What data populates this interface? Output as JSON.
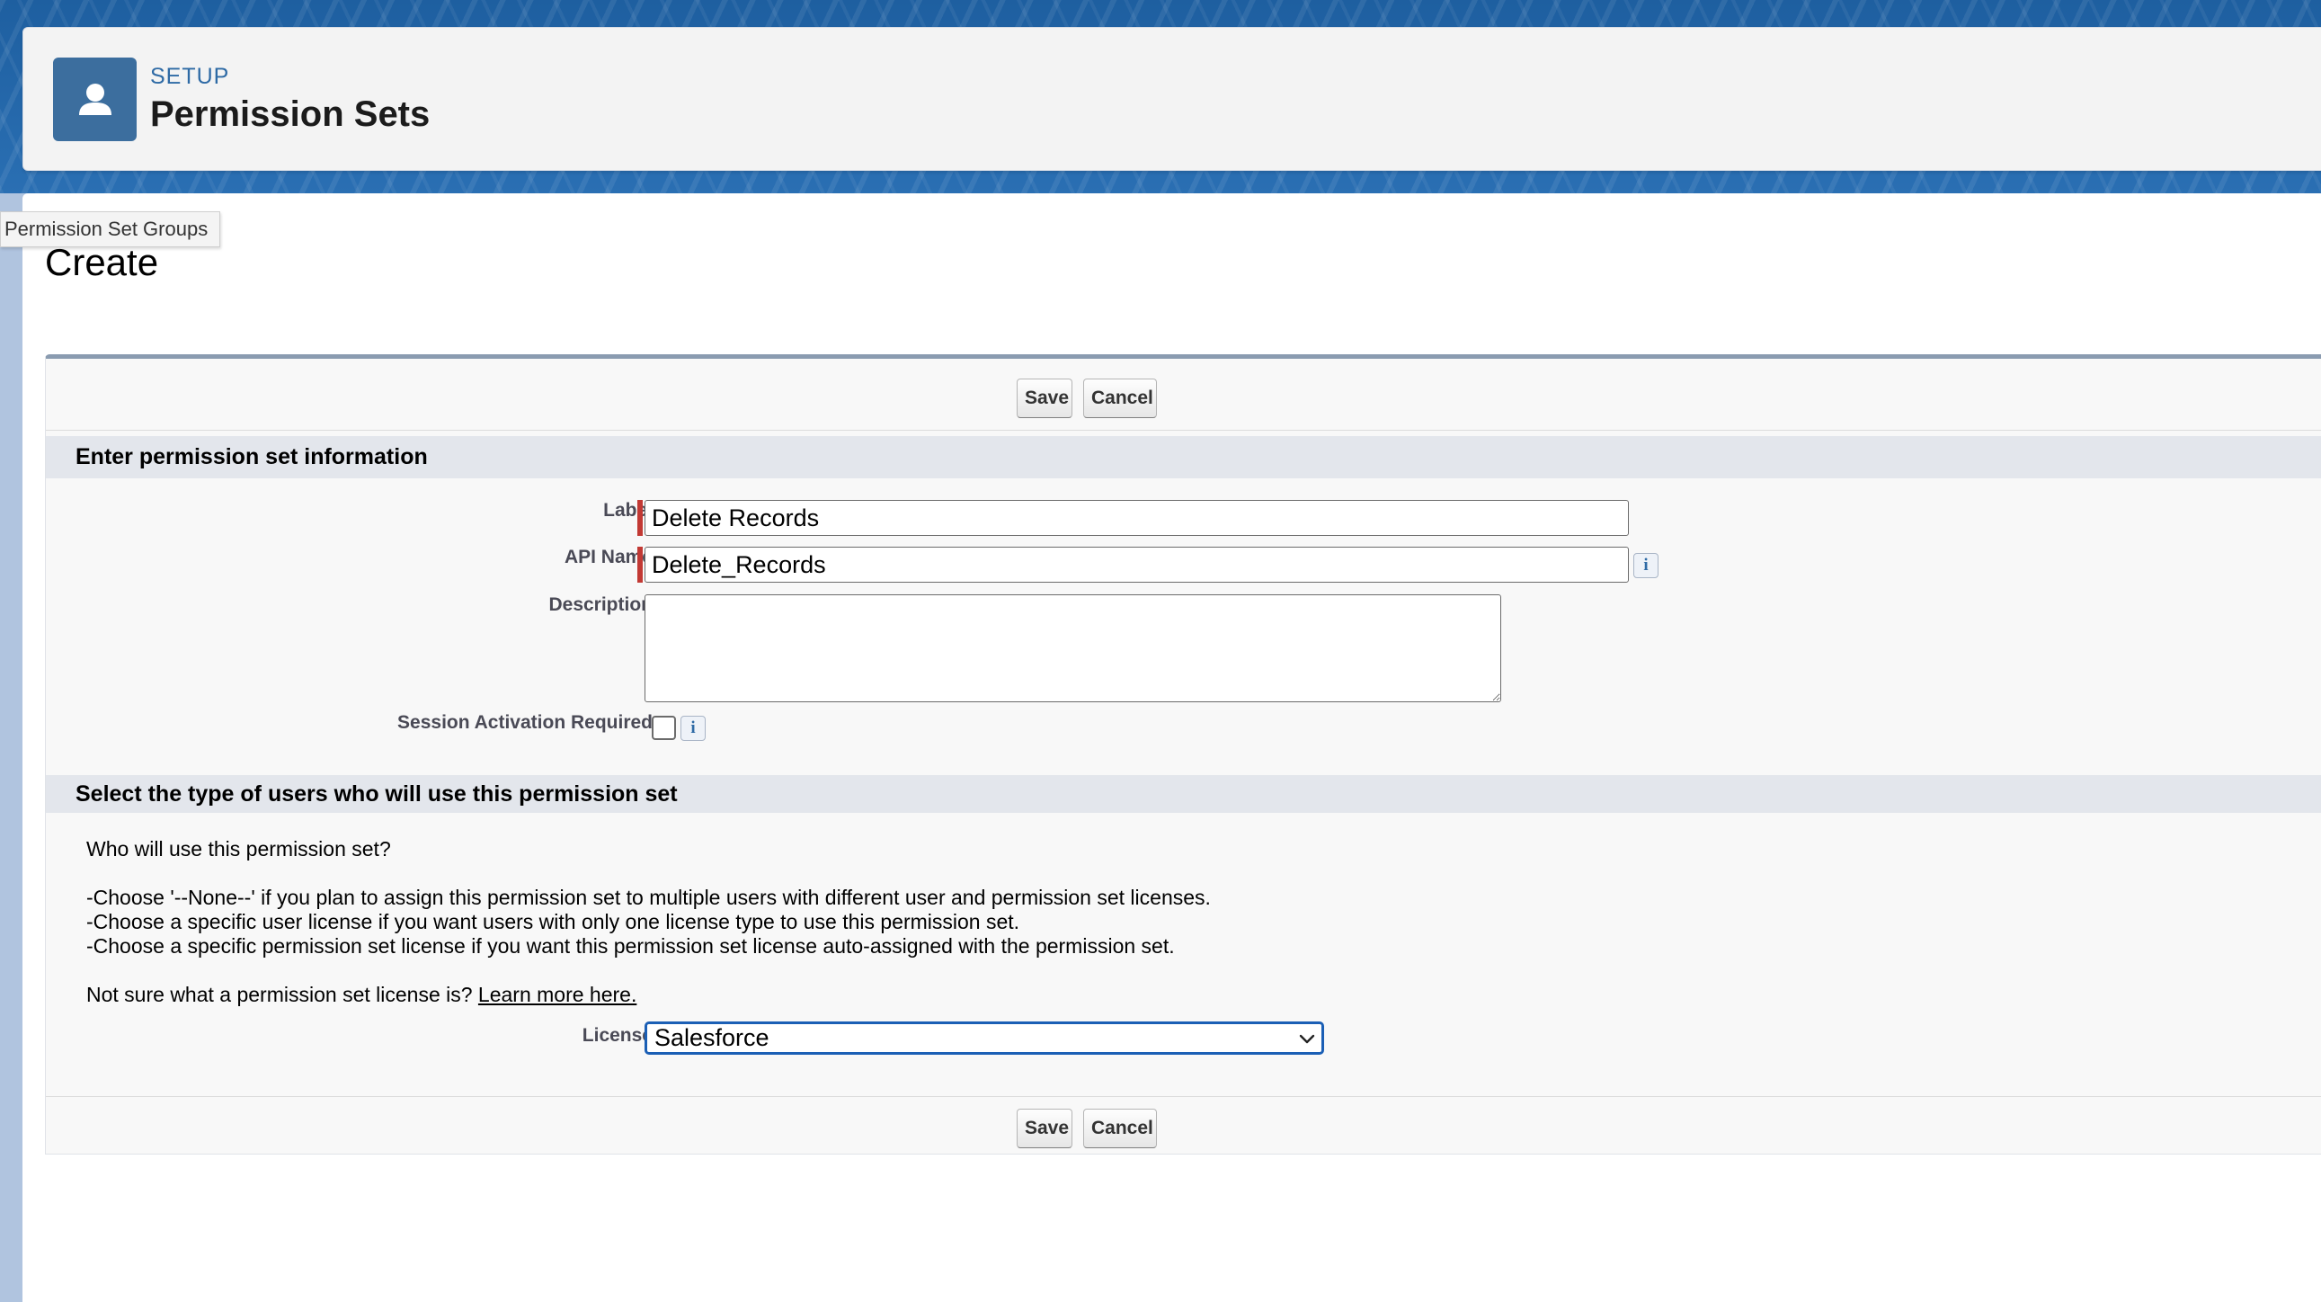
{
  "header": {
    "eyebrow": "SETUP",
    "title": "Permission Sets",
    "icon": "user-icon"
  },
  "tooltip": "Permission Set Groups",
  "page": {
    "heading": "Create"
  },
  "buttons": {
    "save": "Save",
    "cancel": "Cancel"
  },
  "info_section": {
    "title": "Enter permission set information",
    "label_field": {
      "label": "Label",
      "value": "Delete Records"
    },
    "api_name_field": {
      "label": "API Name",
      "value": "Delete_Records"
    },
    "description_field": {
      "label": "Description",
      "value": ""
    },
    "session_field": {
      "label": "Session Activation Required",
      "checked": false
    }
  },
  "users_section": {
    "title": "Select the type of users who will use this permission set",
    "question": "Who will use this permission set?",
    "lines": [
      "-Choose '--None--' if you plan to assign this permission set to multiple users with different user and permission set licenses.",
      "-Choose a specific user license if you want users with only one license type to use this permission set.",
      "-Choose a specific permission set license if you want this permission set license auto-assigned with the permission set."
    ],
    "not_sure_text": "Not sure what a permission set license is?",
    "learn_more": "Learn more here.",
    "license_label": "License",
    "license_value": "Salesforce"
  },
  "colors": {
    "brand_blue": "#1e5fa0",
    "required": "#c23934",
    "focus": "#1b5fb5"
  }
}
